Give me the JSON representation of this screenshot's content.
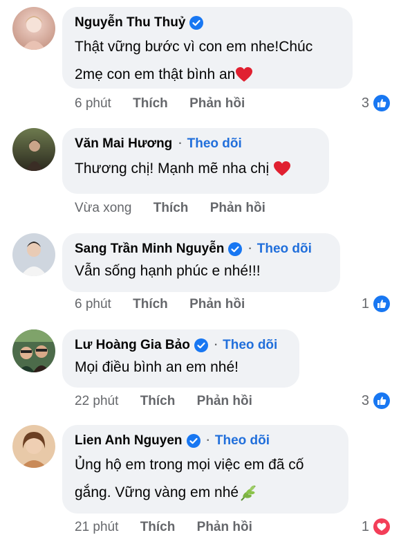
{
  "comments": [
    {
      "name": "Nguyễn Thu Thuỷ",
      "verified": true,
      "follow": "",
      "text_line1": "Thật vững bước vì con em nhe!Chúc",
      "text_line2": "2mẹ con em thật bình an",
      "time": "6 phút",
      "like": "Thích",
      "reply": "Phản hồi",
      "reaction_count": "3",
      "reaction_type": "like-icon"
    },
    {
      "name": "Văn Mai Hương",
      "verified": false,
      "dot": "·",
      "follow": "Theo dõi",
      "text_line1": "Thương chị! Mạnh mẽ nha chị",
      "time": "Vừa xong",
      "like": "Thích",
      "reply": "Phản hồi"
    },
    {
      "name": "Sang Trần Minh Nguyễn",
      "verified": true,
      "dot": "·",
      "follow": "Theo dõi",
      "text_line1": "Vẫn sống hạnh phúc e nhé!!!",
      "time": "6 phút",
      "like": "Thích",
      "reply": "Phản hồi",
      "reaction_count": "1",
      "reaction_type": "like-icon"
    },
    {
      "name": "Lư Hoàng Gia Bảo",
      "verified": true,
      "dot": "·",
      "follow": "Theo dõi",
      "text_line1": "Mọi điều bình an em nhé!",
      "time": "22 phút",
      "like": "Thích",
      "reply": "Phản hồi",
      "reaction_count": "3",
      "reaction_type": "like-icon"
    },
    {
      "name": "Lien Anh Nguyen",
      "verified": true,
      "dot": "·",
      "follow": "Theo dõi",
      "text_line1": "Ủng hộ em trong mọi việc em đã cố",
      "text_line2": "gắng. Vững vàng em nhé",
      "time": "21 phút",
      "like": "Thích",
      "reply": "Phản hồi",
      "reaction_count": "1",
      "reaction_type": "love-icon"
    }
  ],
  "colors": {
    "bubble": "#f0f2f5",
    "link": "#216fdb",
    "meta": "#65676b",
    "like": "#1877f2",
    "love": "#f33e58"
  }
}
